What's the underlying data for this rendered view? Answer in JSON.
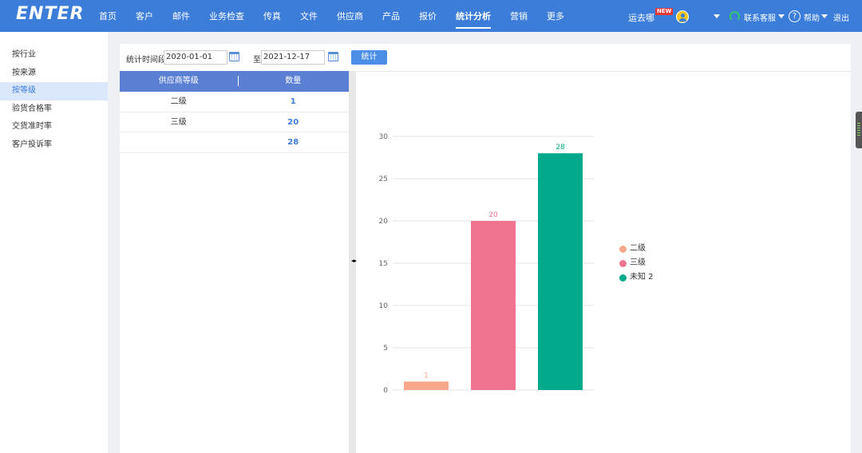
{
  "app": {
    "logo": "ENTER"
  },
  "nav": [
    {
      "label": "首页"
    },
    {
      "label": "客户"
    },
    {
      "label": "邮件"
    },
    {
      "label": "业务检查"
    },
    {
      "label": "传真"
    },
    {
      "label": "文件"
    },
    {
      "label": "供应商"
    },
    {
      "label": "产品"
    },
    {
      "label": "报价"
    },
    {
      "label": "统计分析",
      "active": true
    },
    {
      "label": "营销"
    },
    {
      "label": "更多"
    }
  ],
  "header_right": {
    "user": "运去哪",
    "badge": "NEW",
    "service": "联系客服",
    "help": "帮助",
    "logout": "退出"
  },
  "sidebar": {
    "items": [
      {
        "label": "按行业"
      },
      {
        "label": "按来源"
      },
      {
        "label": "按等级",
        "active": true
      },
      {
        "label": "验货合格率"
      },
      {
        "label": "交货准时率"
      },
      {
        "label": "客户投诉率"
      }
    ]
  },
  "filter": {
    "label": "统计时间段",
    "start_date": "2020-01-01",
    "to_label": "至",
    "end_date": "2021-12-17",
    "button": "统计"
  },
  "table": {
    "headers": [
      "供应商等级",
      "数量"
    ],
    "rows": [
      {
        "grade": "二级",
        "count": "1"
      },
      {
        "grade": "三级",
        "count": "20"
      },
      {
        "grade": "",
        "count": "28"
      }
    ]
  },
  "chart_data": {
    "type": "bar",
    "categories": [
      "二级",
      "三级",
      "未知 2"
    ],
    "values": [
      1,
      20,
      28
    ],
    "colors": [
      "#f9a78a",
      "#f0738f",
      "#03a98b"
    ],
    "legend": [
      "二级",
      "三级",
      "未知 2"
    ],
    "legend_position": "right",
    "ylim": [
      0,
      30
    ],
    "yticks": [
      0,
      5,
      10,
      15,
      20,
      25,
      30
    ],
    "grid": true,
    "title": "",
    "xlabel": "",
    "ylabel": ""
  }
}
